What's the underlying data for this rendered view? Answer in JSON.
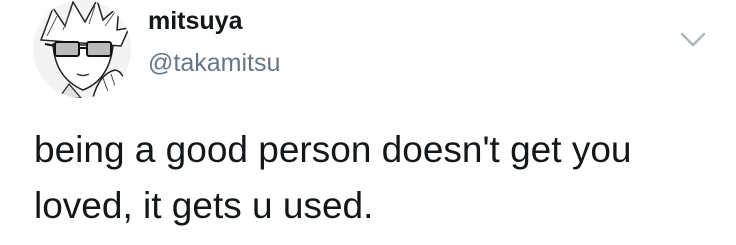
{
  "tweet": {
    "author": {
      "display_name": "mitsuya",
      "handle": "@takamitsu",
      "avatar_icon": "avatar-manga-character-with-glasses"
    },
    "menu_icon": "chevron-down-icon",
    "text_line_1": "being a good person doesn't get you",
    "text_line_2": "loved, it gets u used."
  },
  "colors": {
    "text": "#14171a",
    "secondary_text": "#657786",
    "chevron": "#aab8c2",
    "background": "#ffffff"
  }
}
